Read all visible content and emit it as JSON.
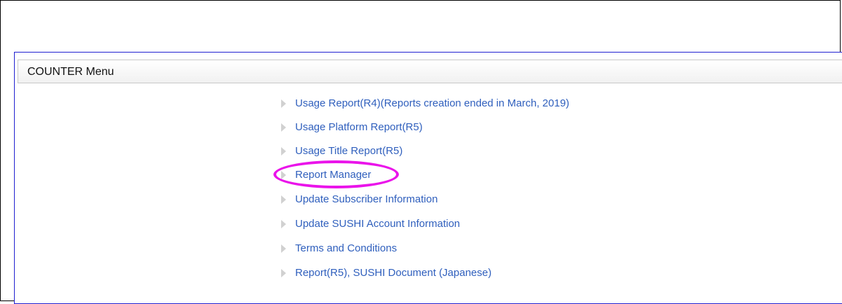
{
  "counter_menu": {
    "title": "COUNTER Menu",
    "items": [
      {
        "label": "Usage Report(R4)(Reports creation ended in March, 2019)"
      },
      {
        "label": "Usage Platform Report(R5)"
      },
      {
        "label": "Usage Title Report(R5)"
      },
      {
        "label": "Report Manager"
      },
      {
        "label": "Update Subscriber Information"
      },
      {
        "label": "Update SUSHI Account Information"
      },
      {
        "label": "Terms and Conditions"
      },
      {
        "label": "Report(R5), SUSHI Document (Japanese)"
      }
    ]
  },
  "colors": {
    "link": "#2f5fbd",
    "panel_border": "#1f1fd0",
    "highlight": "#ea13ea",
    "bullet": "#d1d1d1"
  },
  "icons": {
    "bullet": "triangle-right-icon"
  }
}
